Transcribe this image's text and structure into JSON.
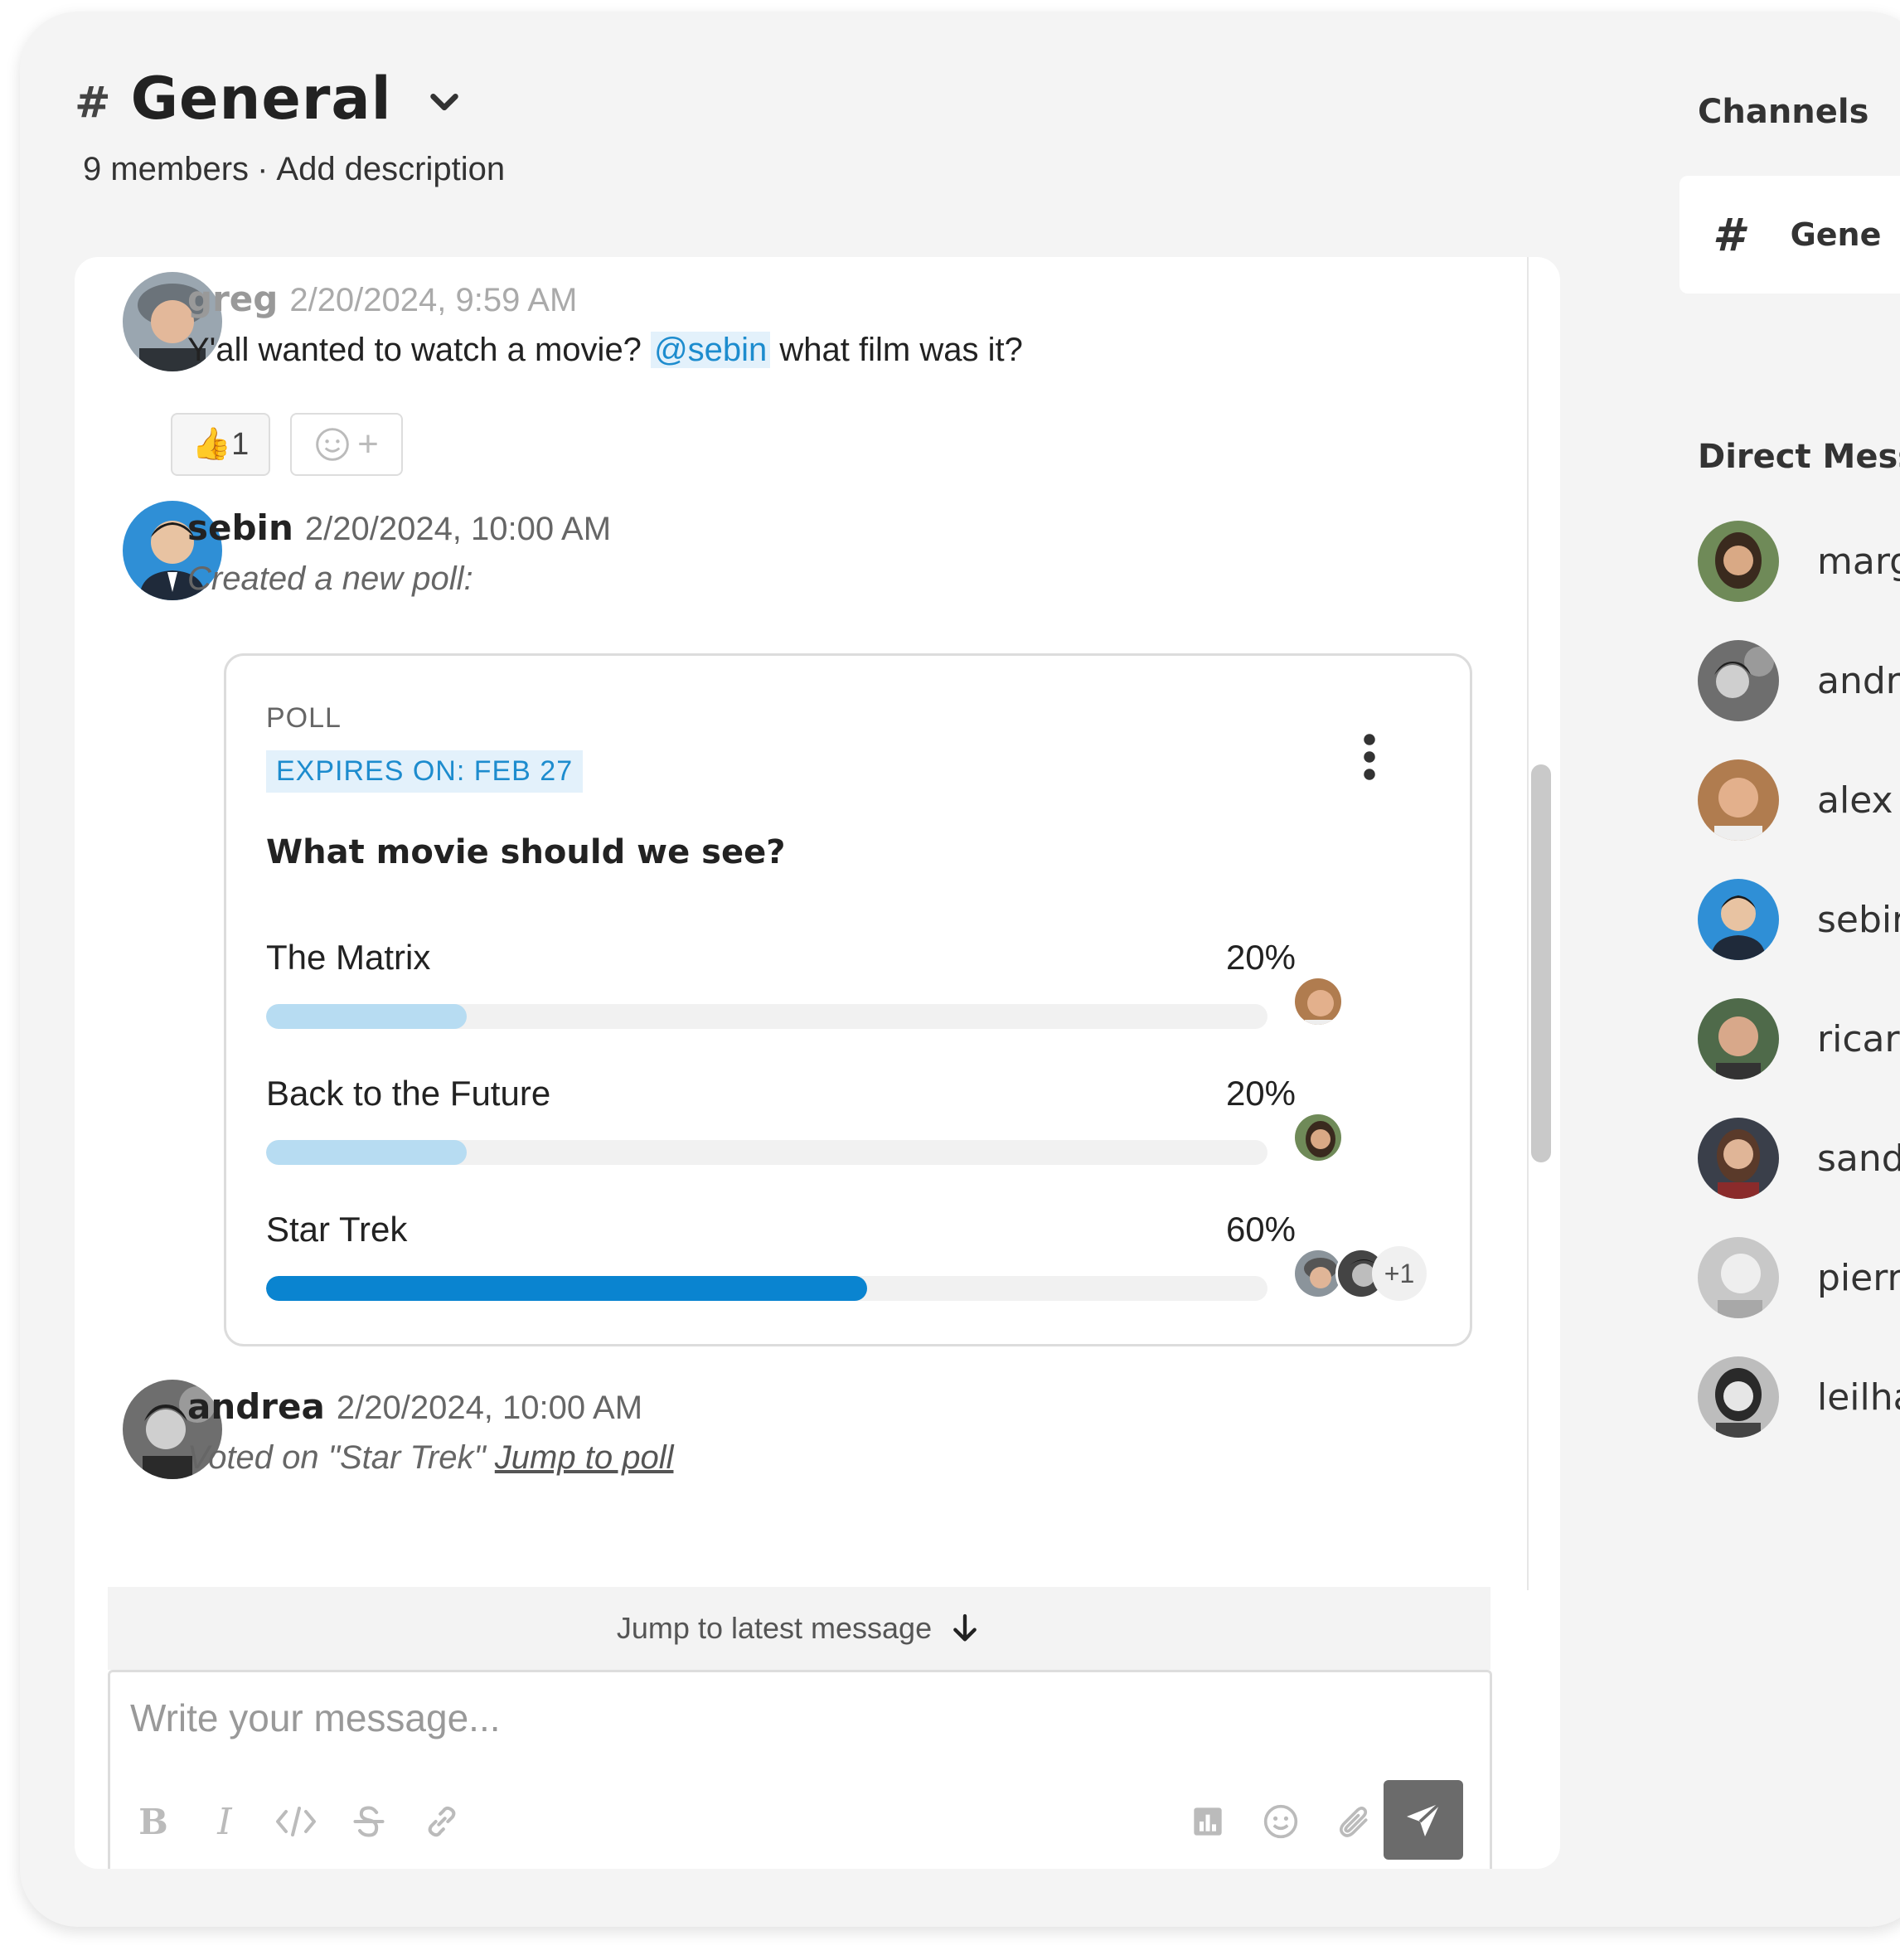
{
  "channel": {
    "hash": "#",
    "name": "General",
    "members": "9 members",
    "separator": "·",
    "add_description": "Add description"
  },
  "messages": [
    {
      "user": "greg",
      "time": "2/20/2024, 9:59 AM",
      "text_before": "Y'all wanted to watch a movie?",
      "mention": "@sebin",
      "text_after": "what film was it?",
      "reactions": [
        {
          "emoji": "👍",
          "count": "1"
        }
      ],
      "add_reaction_label": "+"
    },
    {
      "user": "sebin",
      "time": "2/20/2024, 10:00 AM",
      "text": "Created a new poll:"
    },
    {
      "user": "andrea",
      "time": "2/20/2024, 10:00 AM",
      "text": "Voted on \"Star Trek\"",
      "link": "Jump to poll"
    }
  ],
  "poll": {
    "label": "POLL",
    "expires": "EXPIRES ON: FEB 27",
    "question": "What movie should we see?",
    "options": [
      {
        "label": "The Matrix",
        "percent_label": "20%",
        "percent": 20,
        "fill": "#b7dcf2"
      },
      {
        "label": "Back to the Future",
        "percent_label": "20%",
        "percent": 20,
        "fill": "#b7dcf2"
      },
      {
        "label": "Star Trek",
        "percent_label": "60%",
        "percent": 60,
        "fill": "#0a84d0"
      }
    ],
    "extra_voters": "+1"
  },
  "jump_latest": "Jump to latest message",
  "composer": {
    "placeholder": "Write your message...",
    "tools": [
      "bold-icon",
      "italic-icon",
      "code-icon",
      "strikethrough-icon",
      "link-icon",
      "poll-icon",
      "emoji-icon",
      "attachment-icon"
    ],
    "send_icon": "send-icon"
  },
  "sidebar": {
    "channels_heading": "Channels",
    "channel_hash": "#",
    "channel_name": "Gene",
    "dm_heading": "Direct Mess",
    "dms": [
      {
        "name": "marg"
      },
      {
        "name": "andr"
      },
      {
        "name": "alex"
      },
      {
        "name": "sebir"
      },
      {
        "name": "ricar"
      },
      {
        "name": "sand"
      },
      {
        "name": "pierr"
      },
      {
        "name": "leilha"
      }
    ]
  },
  "colors": {
    "accent": "#0a84d0",
    "accent_light": "#b7dcf2",
    "mention_bg": "#e3f1fb",
    "background": "#f4f4f4"
  }
}
